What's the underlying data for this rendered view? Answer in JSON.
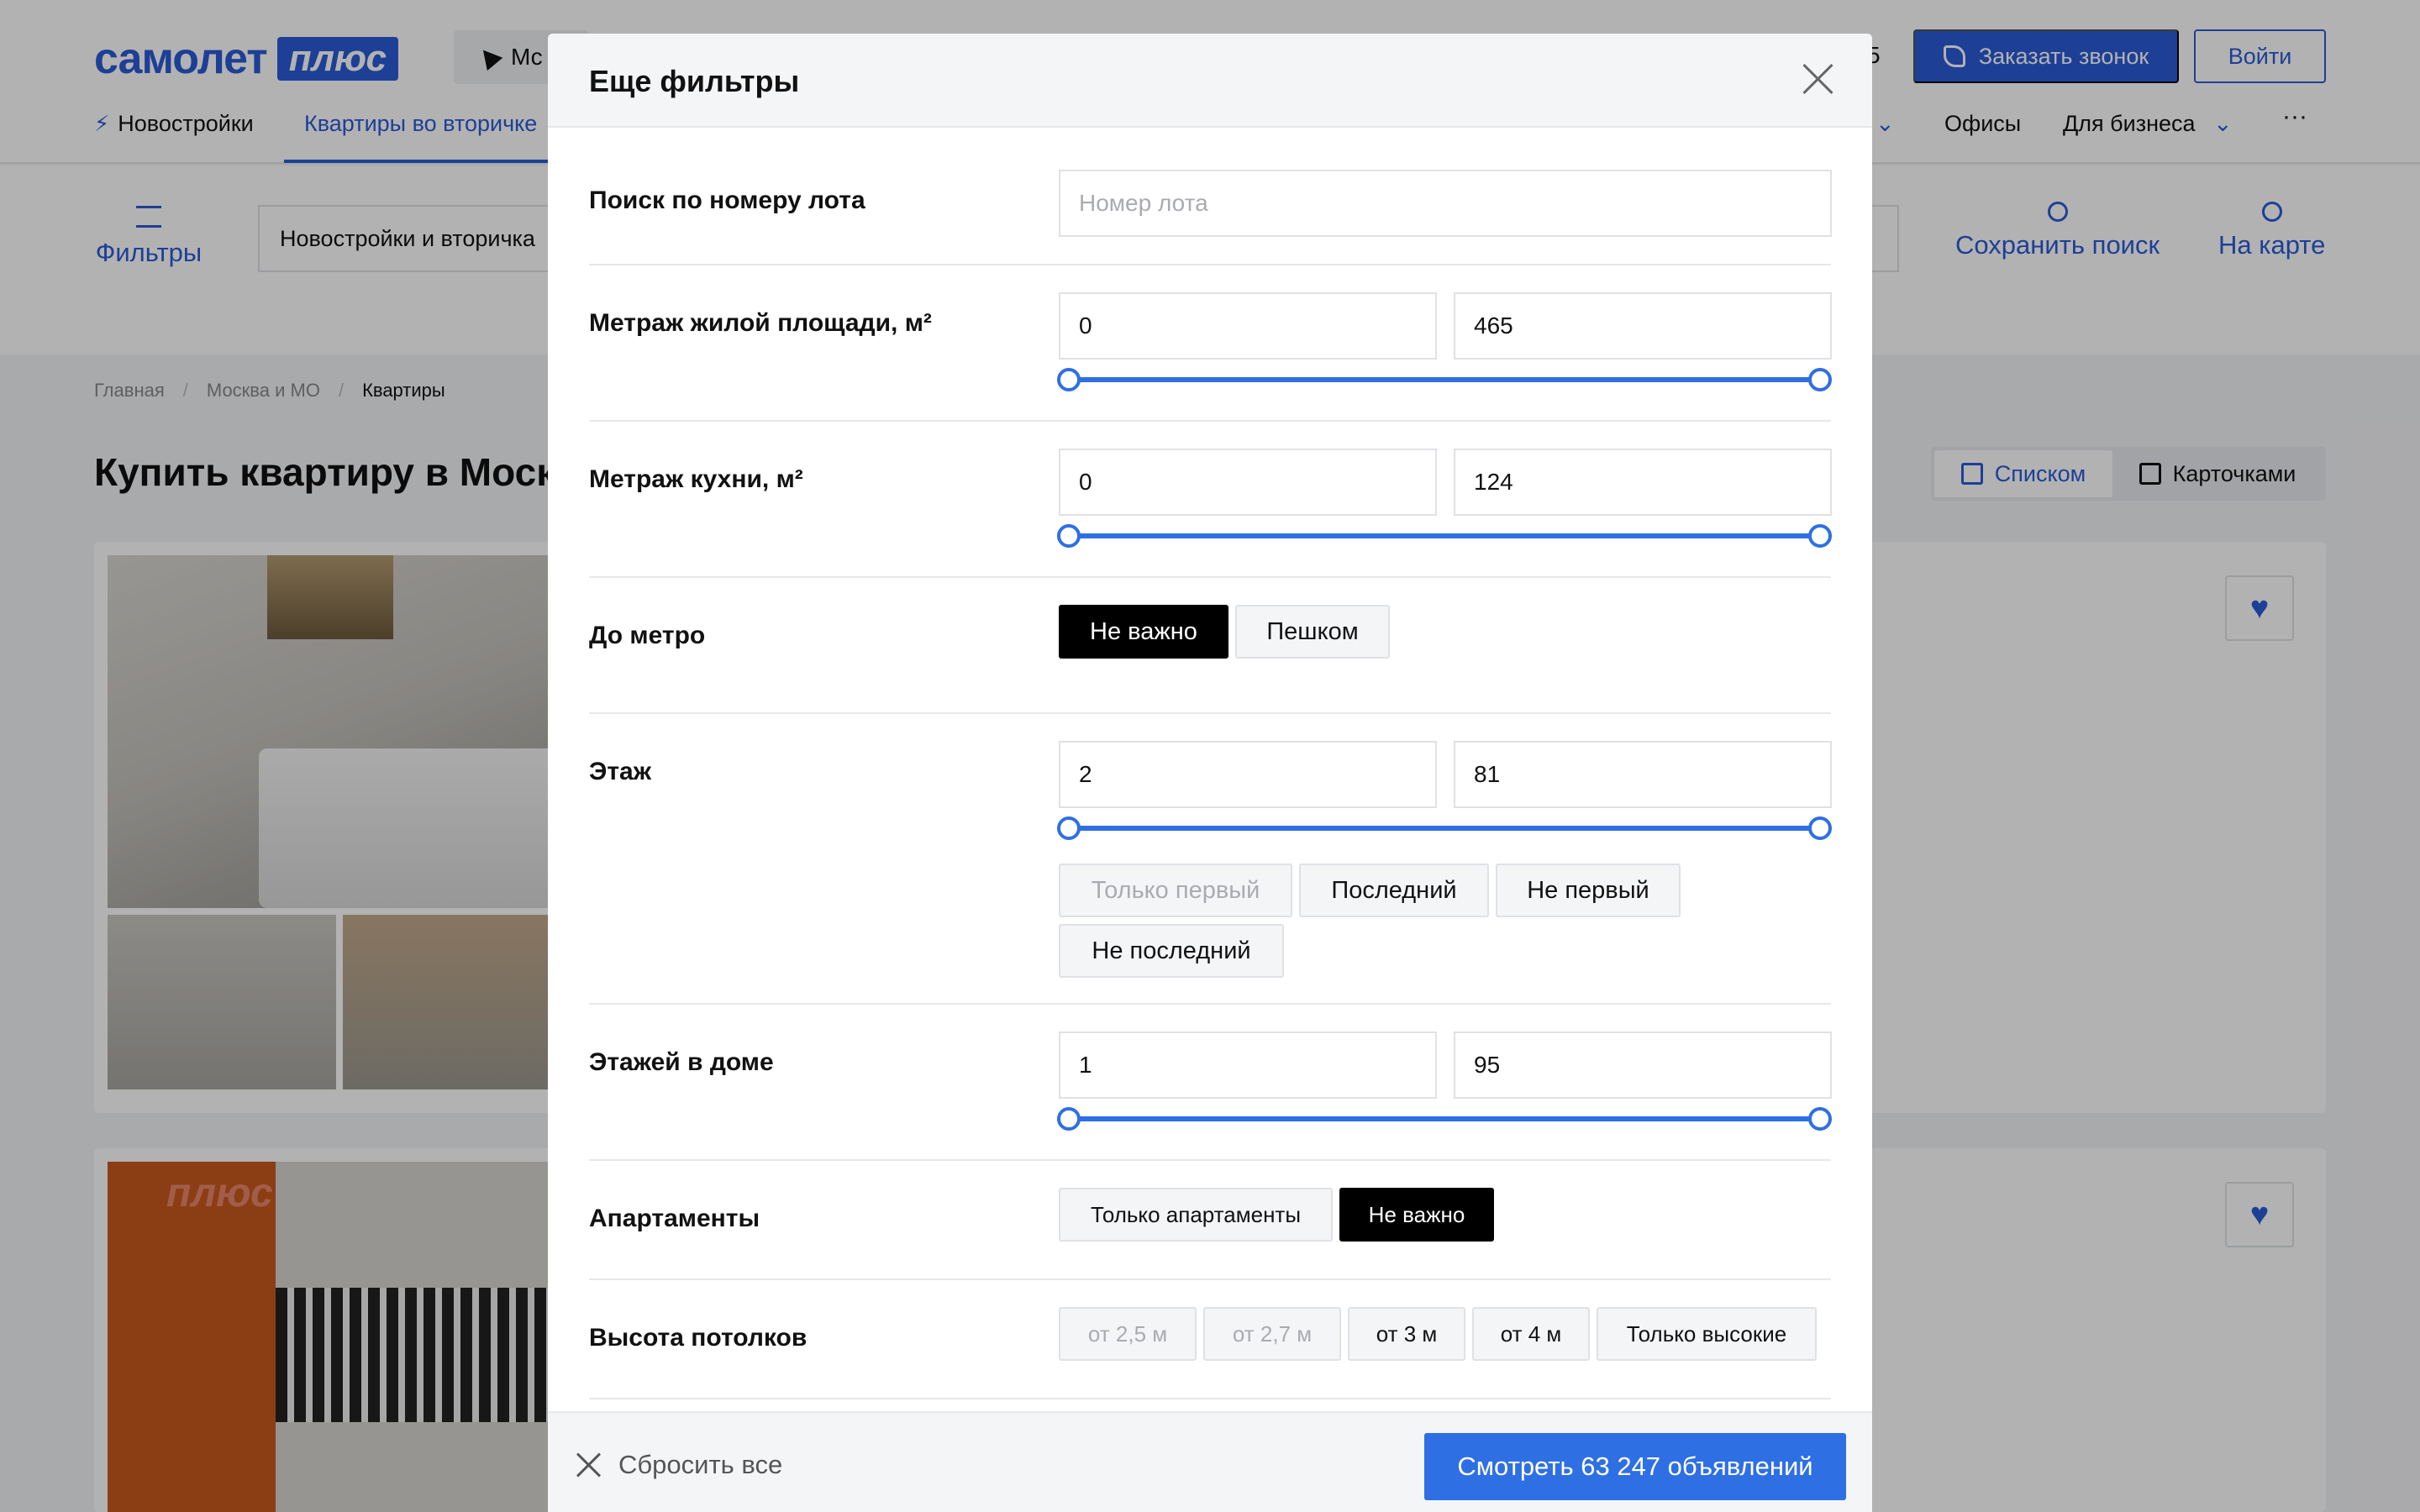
{
  "colors": {
    "brand": "#2a5bd7",
    "accent": "#2f6fe4",
    "selected_chip": "#000000"
  },
  "background": {
    "logo": {
      "main": "самолет",
      "plus": "плюс"
    },
    "city_short": "Мс",
    "phone_tail": "5",
    "call_button": "Заказать звонок",
    "login_button": "Войти",
    "nav": {
      "new_buildings": "Новостройки",
      "secondary": "Квартиры во вторичке",
      "offices": "Офисы",
      "business": "Для бизнеса",
      "more": "···"
    },
    "filters_link": "Фильтры",
    "type_select": "Новостройки и вторичка",
    "save_search": "Сохранить поиск",
    "on_map": "На карте",
    "breadcrumbs": [
      "Главная",
      "Москва и МО",
      "Квартиры"
    ],
    "breadcrumb_sep": "/",
    "page_title": "Купить квартиру в Моск",
    "view_list": "Списком",
    "view_cards": "Карточками",
    "plus_watermark": "плюс"
  },
  "modal": {
    "title": "Еще фильтры",
    "lot": {
      "label": "Поиск по номеру лота",
      "placeholder": "Номер лота",
      "value": ""
    },
    "living_area": {
      "label": "Метраж жилой площади, м²",
      "from": "0",
      "to": "465",
      "range_fraction": [
        0,
        1
      ]
    },
    "kitchen_area": {
      "label": "Метраж кухни, м²",
      "from": "0",
      "to": "124",
      "range_fraction": [
        0,
        1
      ]
    },
    "metro": {
      "label": "До метро",
      "options": [
        "Не важно",
        "Пешком"
      ],
      "selected": "Не важно"
    },
    "floor": {
      "label": "Этаж",
      "from": "2",
      "to": "81",
      "range_fraction": [
        0,
        1
      ],
      "options": [
        "Только первый",
        "Последний",
        "Не первый",
        "Не последний"
      ],
      "disabled": [
        "Только первый"
      ]
    },
    "floors_total": {
      "label": "Этажей в доме",
      "from": "1",
      "to": "95",
      "range_fraction": [
        0,
        1
      ]
    },
    "apartments": {
      "label": "Апартаменты",
      "options": [
        "Только апартаменты",
        "Не важно"
      ],
      "selected": "Не важно"
    },
    "ceiling": {
      "label": "Высота потолков",
      "options": [
        "от 2,5 м",
        "от 2,7 м",
        "от 3 м",
        "от 4 м",
        "Только высокие"
      ],
      "disabled": [
        "от 2,5 м",
        "от 2,7 м"
      ]
    },
    "footer": {
      "reset": "Сбросить все",
      "show": "Смотреть 63 247 объявлений"
    }
  }
}
